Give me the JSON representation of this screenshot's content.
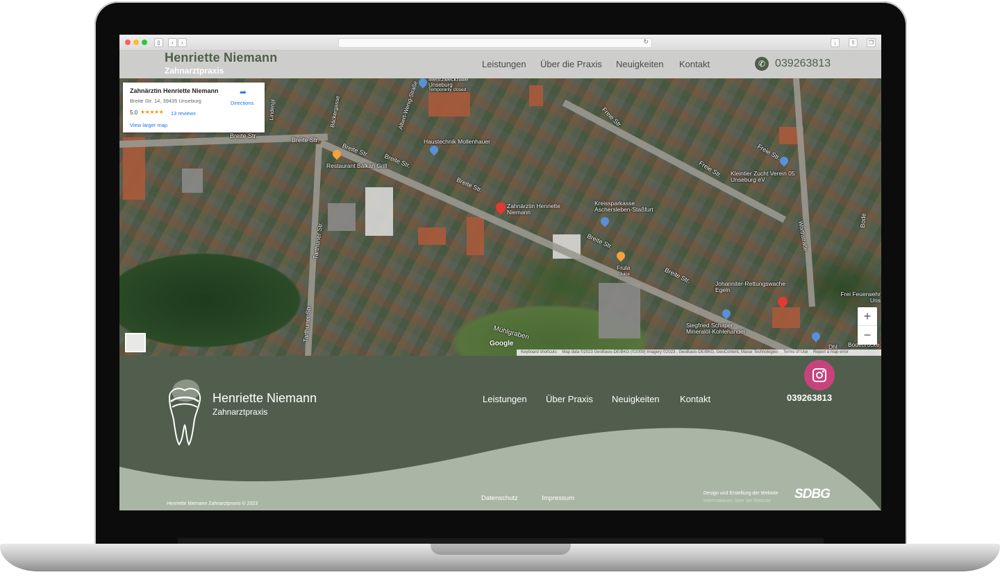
{
  "site": {
    "brand_name": "Henriette Niemann",
    "brand_sub": "Zahnarztpraxis",
    "nav": [
      "Leistungen",
      "Über die Praxis",
      "Neuigkeiten",
      "Kontakt"
    ],
    "phone": "039263813"
  },
  "map": {
    "info_card": {
      "title": "Zahnärztin Henriette Niemann",
      "address": "Breite Str. 14, 39435 Unseburg",
      "rating": "5.0",
      "stars": "★★★★★",
      "reviews": "13 reviews",
      "view_larger": "View larger map",
      "directions": "Directions"
    },
    "labels": {
      "breite_1": "Breite Str.",
      "breite_2": "Breite Str.",
      "breite_3": "Breite Str.",
      "breite_4": "Breite Str.",
      "breite_5": "Breite Str.",
      "breite_6": "Breite Str.",
      "breite_7": "Breite Str.",
      "tarthuner_1": "Tarthuner Str.",
      "tarthuner_2": "Tarthuner Str.",
      "restaurant": "Restaurant Balkan Grill",
      "haustechnik": "Haustechnik Mollenhauer",
      "mehrzweckhalle": "Mehrzweckhalle Unseburg",
      "temp_closed": "Temporarily closed",
      "zahnarztin": "Zahnärztin Henriette Niemann",
      "kreissparkasse": "Kreissparkasse Aschersleben-Staßfurt",
      "frula": "Frula",
      "juice": "Juice",
      "kleintier": "Kleintier Zucht Verein 05 Unseburg eV",
      "johanniter": "Johanniter-Rettungswache Egeln",
      "siegfried": "Siegfried Schaper Mineralöl-Kohlehandel",
      "feuerwehr": "Frei Feuerwehr Uns",
      "freie_str_1": "Freie Str.",
      "freie_str_2": "Freie Str.",
      "freie_str_3": "Freie Str.",
      "muehlgraben": "Mühlgraben",
      "bode": "Bode",
      "worthstrasse": "Wörthstraße",
      "lindenpl": "Lindenpl",
      "baeckergasse": "Bäckergasse",
      "albert": "Albert-Wenig-Straße",
      "dhl": "Dhl",
      "bodebruecke": "Bodebrücke"
    },
    "google": "Google",
    "footer_links": [
      "Keyboard shortcuts",
      "Map data ©2023 GeoBasis-DE/BKG (©2009) Imagery ©2023 , GeoBasis-DE/BKG, GeoContent, Maxar Technologies",
      "Terms of Use",
      "Report a map error"
    ],
    "zoom_in": "+",
    "zoom_out": "−"
  },
  "footer": {
    "name": "Henriette Niemann",
    "sub": "Zahnarztpraxis",
    "nav": [
      "Leistungen",
      "Über Praxis",
      "Neuigkeiten",
      "Kontakt"
    ],
    "phone": "039263813",
    "copyright": "Henriette Niemann Zahnarztpraxis © 2023",
    "legal": [
      "Datenschutz",
      "Impressum"
    ],
    "design_credit": "Design und Erstellung der Website",
    "design_info": "Informationen über die Website",
    "design_brand": "SDBG"
  },
  "colors": {
    "brand_green": "#515e4d",
    "header_bg": "#cdcdcb",
    "wave": "#a9b5a5",
    "instagram": "#c8437e"
  },
  "icons": [
    "phone-icon",
    "instagram-icon",
    "tooth-logo-icon",
    "directions-icon",
    "map-pin-icon"
  ]
}
